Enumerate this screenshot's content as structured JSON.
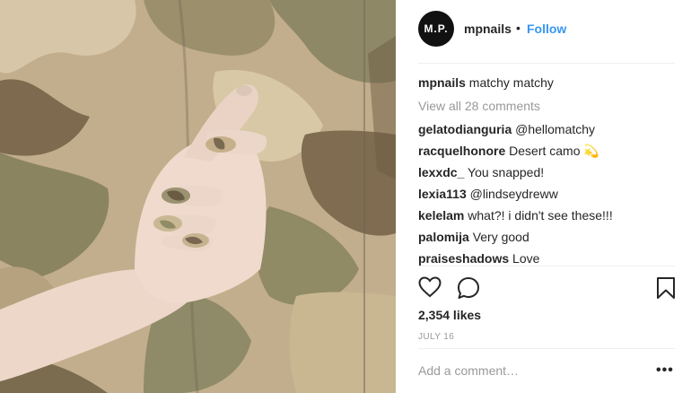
{
  "header": {
    "avatar_text": "M.P.",
    "username": "mpnails",
    "dot": "•",
    "follow_label": "Follow"
  },
  "caption": {
    "user": "mpnails",
    "text": "matchy matchy"
  },
  "view_all_comments": "View all 28 comments",
  "comments": [
    {
      "user": "gelatodianguria",
      "text": "@hellomatchy"
    },
    {
      "user": "racquelhonore",
      "text": "Desert camo 💫"
    },
    {
      "user": "lexxdc_",
      "text": "You snapped!"
    },
    {
      "user": "lexia113",
      "text": "@lindseydreww"
    },
    {
      "user": "kelelam",
      "text": "what?! i didn't see these!!!"
    },
    {
      "user": "palomija",
      "text": "Very good"
    },
    {
      "user": "praiseshadows",
      "text": "Love"
    }
  ],
  "likes": "2,354 likes",
  "date": "JULY 16",
  "add_comment_placeholder": "Add a comment…",
  "more_label": "•••",
  "icons": [
    "heart-icon",
    "comment-icon",
    "bookmark-icon",
    "more-options-icon"
  ],
  "colors": {
    "follow": "#3897f0",
    "mention": "#003569",
    "muted": "#999999",
    "divider": "#efefef"
  }
}
